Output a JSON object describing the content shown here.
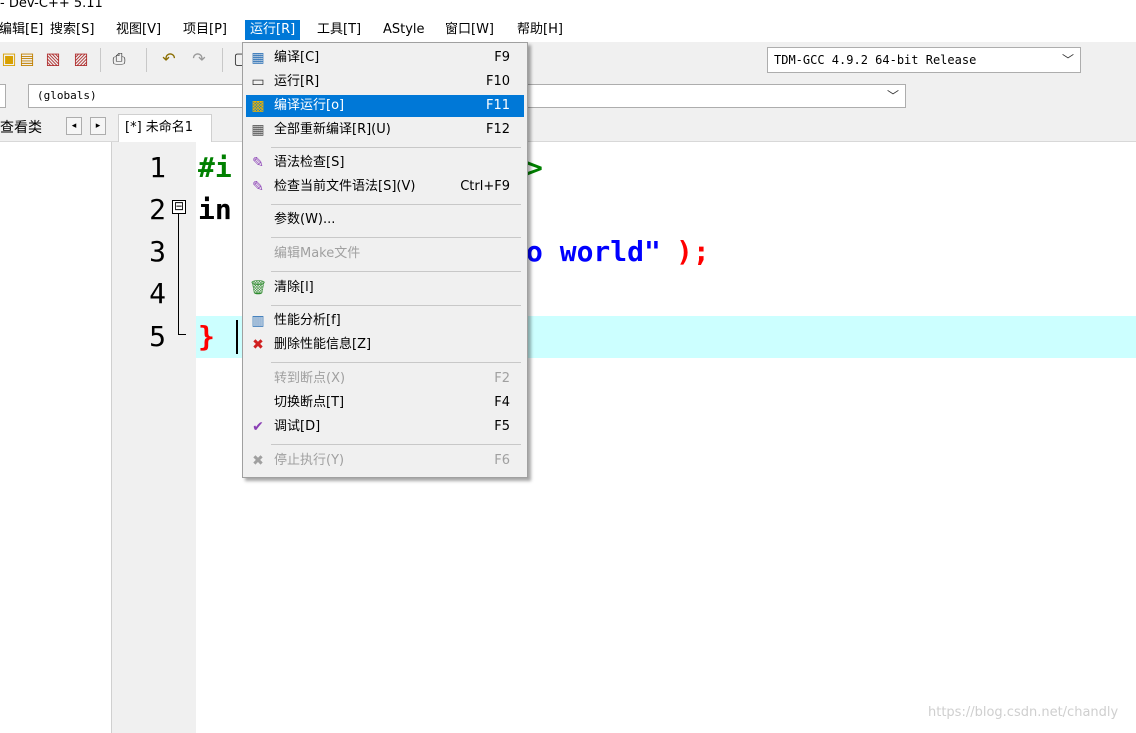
{
  "window": {
    "title": "- Dev-C++ 5.11"
  },
  "menubar": [
    {
      "label": "编辑[E]"
    },
    {
      "label": "搜索[S]"
    },
    {
      "label": "视图[V]"
    },
    {
      "label": "项目[P]"
    },
    {
      "label": "运行[R]"
    },
    {
      "label": "工具[T]"
    },
    {
      "label": "AStyle"
    },
    {
      "label": "窗口[W]"
    },
    {
      "label": "帮助[H]"
    }
  ],
  "toolbar": {
    "compiler": "TDM-GCC 4.9.2 64-bit Release",
    "scope": "(globals)"
  },
  "left_panel": {
    "tab": "查看类",
    "prev": "◂",
    "next": "▸"
  },
  "editor": {
    "file_tab": "[*] 未命名1",
    "line_numbers": [
      "1",
      "2",
      "3",
      "4",
      "5"
    ],
    "fold_glyph": "⊟",
    "code": {
      "l1_visible": "#i",
      "l1_tail": ">",
      "l2_visible": "in",
      "l3_string": "o world\"",
      "l3_end": ");",
      "l5_brace": "}"
    }
  },
  "run_menu": {
    "items": [
      {
        "icon": "grid-icon",
        "glyph": "▦",
        "label": "编译[C]",
        "shortcut": "F9"
      },
      {
        "icon": "window-icon",
        "glyph": "▭",
        "label": "运行[R]",
        "shortcut": "F10"
      },
      {
        "icon": "compile-run-icon",
        "glyph": "▩",
        "label": "编译运行[o]",
        "shortcut": "F11"
      },
      {
        "icon": "rebuild-icon",
        "glyph": "▦",
        "label": "全部重新编译[R](U)",
        "shortcut": "F12"
      },
      {
        "icon": "syntax-check-icon",
        "glyph": "✎",
        "label": "语法检查[S]",
        "shortcut": ""
      },
      {
        "icon": "file-check-icon",
        "glyph": "✎",
        "label": "检查当前文件语法[S](V)",
        "shortcut": "Ctrl+F9"
      },
      {
        "icon": "",
        "glyph": "",
        "label": "参数(W)...",
        "shortcut": ""
      },
      {
        "icon": "",
        "glyph": "",
        "label": "编辑Make文件",
        "shortcut": ""
      },
      {
        "icon": "trash-icon",
        "glyph": "🗑",
        "label": "清除[l]",
        "shortcut": ""
      },
      {
        "icon": "bar-chart-icon",
        "glyph": "▥",
        "label": "性能分析[f]",
        "shortcut": ""
      },
      {
        "icon": "delete-profile-icon",
        "glyph": "✖",
        "label": "删除性能信息[Z]",
        "shortcut": ""
      },
      {
        "icon": "",
        "glyph": "",
        "label": "转到断点(X)",
        "shortcut": "F2"
      },
      {
        "icon": "",
        "glyph": "",
        "label": "切换断点[T]",
        "shortcut": "F4"
      },
      {
        "icon": "debug-check-icon",
        "glyph": "✔",
        "label": "调试[D]",
        "shortcut": "F5"
      },
      {
        "icon": "stop-icon",
        "glyph": "✖",
        "label": "停止执行(Y)",
        "shortcut": "F6"
      }
    ]
  },
  "watermark": "https://blog.csdn.net/chandly",
  "colors": {
    "menu_highlight": "#0078d7",
    "current_line": "#ccffff",
    "preprocessor": "#008000",
    "string": "#0000ff",
    "symbol": "#ff0000"
  }
}
